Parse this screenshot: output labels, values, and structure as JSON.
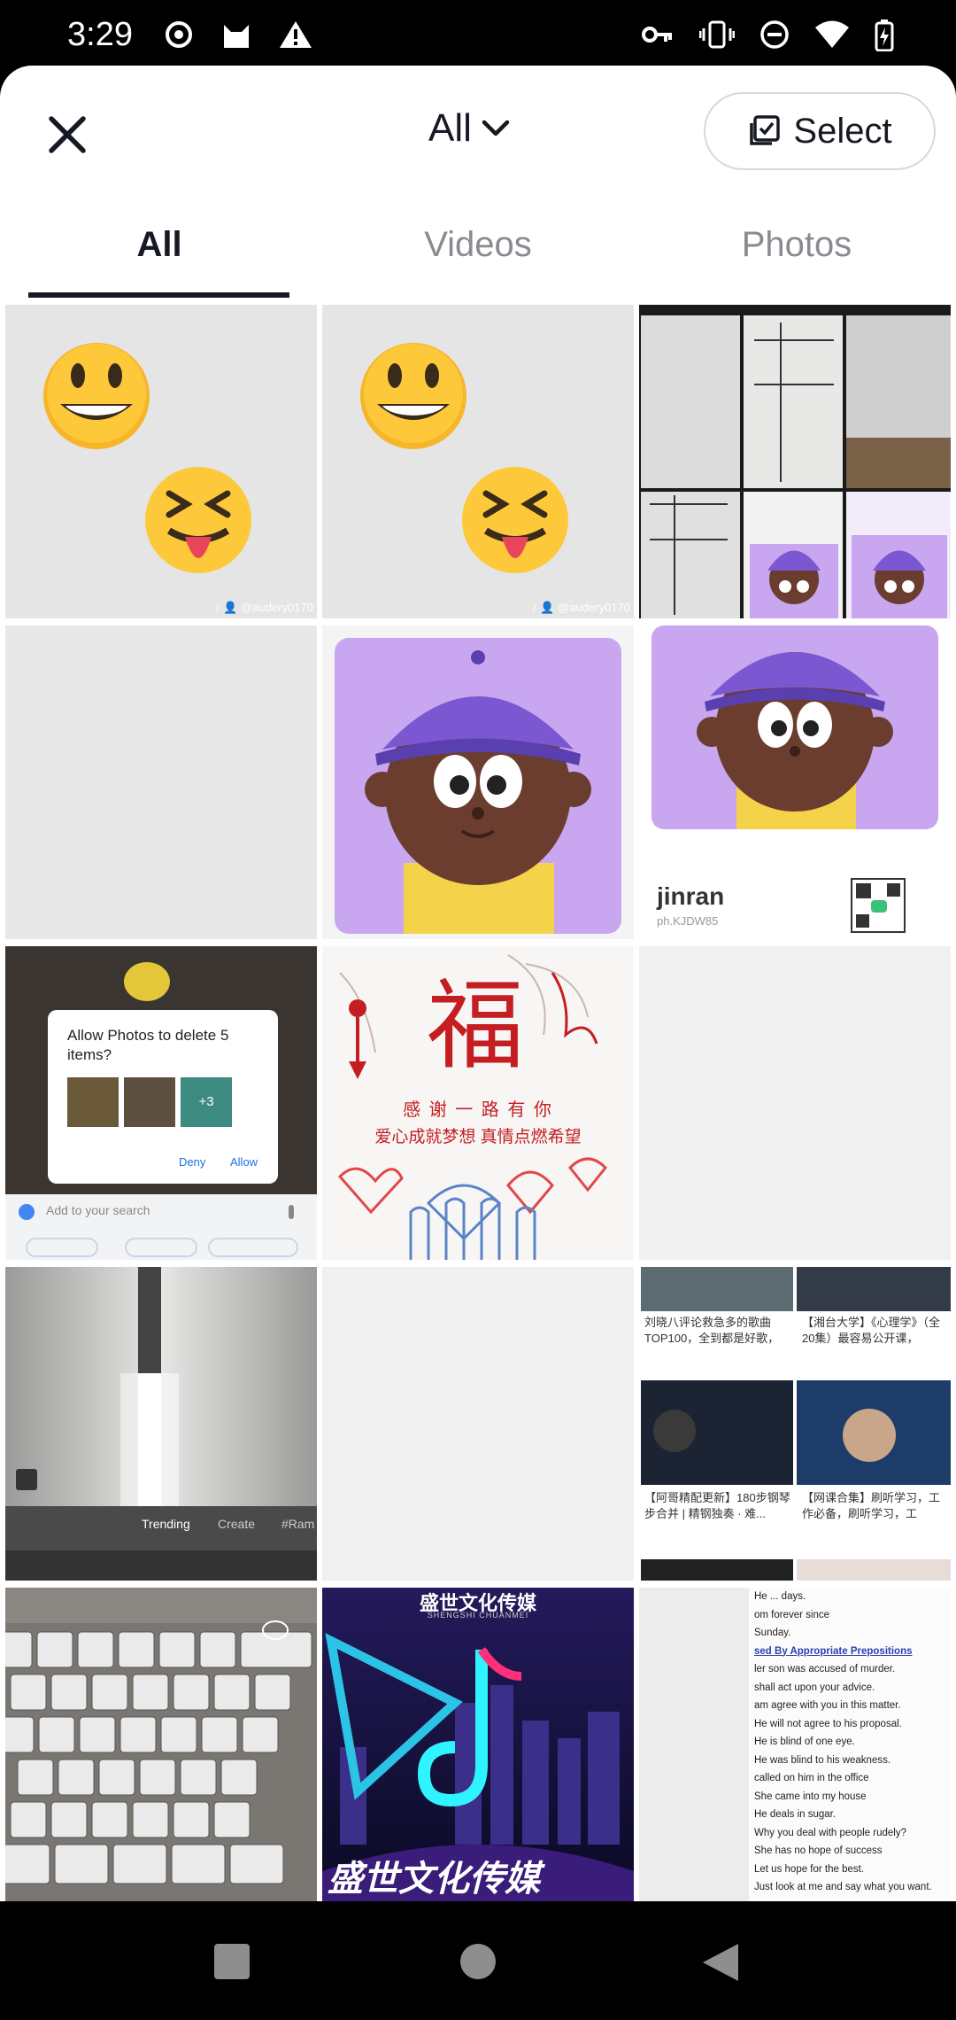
{
  "status_bar": {
    "time": "3:29",
    "left_icons": [
      "record-icon",
      "cat-icon",
      "warning-icon"
    ],
    "right_icons": [
      "key-icon",
      "vibrate-icon",
      "dnd-icon",
      "wifi-icon",
      "battery-charging-icon"
    ]
  },
  "header": {
    "album_label": "All",
    "select_label": "Select"
  },
  "tabs": [
    {
      "label": "All",
      "active": true
    },
    {
      "label": "Videos",
      "active": false
    },
    {
      "label": "Photos",
      "active": false
    }
  ],
  "thumbnails": {
    "emoji_watermark": "♪ 👤 @audery0170",
    "avatar_name": "jinran",
    "avatar_id": "ph.KJDW85",
    "dialog_title": "Allow Photos to delete 5 items?",
    "dialog_plus": "+3",
    "dialog_deny": "Deny",
    "dialog_allow": "Allow",
    "search_placeholder": "Add to your search",
    "fu_char": "福",
    "fu_line1": "感 谢 一 路 有 你",
    "fu_line2": "爱心成就梦想  真情点燃希望",
    "trending_tab": "Trending",
    "create_tab": "Create",
    "hashtag_tab": "#Ram",
    "media_brand_top": "盛世文化传媒",
    "media_brand_sub": "SHENGSHI CHUANMEI",
    "media_brand": "盛世文化传媒",
    "news1": "刘晓八评论救急多的歌曲TOP100，全到都是好歌，",
    "news2": "【湘台大学】《心理学》（全20集）最容易公开课，",
    "news3": "【阿哥精配更新】180步钢琴步合并 | 精钢独奏 · 难...",
    "news4": "【网课合集】刷听学习，工作必备，刷听学习，工",
    "eng_lines": [
      "He ... days.",
      "om forever since",
      "Sunday.",
      "sed By Appropriate Prepositions",
      "ler son was accused of murder.",
      "shall act upon your advice.",
      "am agree with you in this matter.",
      "He will not agree to his proposal.",
      "He is blind of one eye.",
      "He was blind to his weakness.",
      "called on him in the office",
      "She came into my house",
      "He deals in sugar.",
      "Why you deal with people rudely?",
      "She has no hope of success",
      "Let us hope for the best.",
      "Just look at me and say what you want."
    ]
  },
  "nav_bar": {
    "icons": [
      "recents-square-icon",
      "home-circle-icon",
      "back-triangle-icon"
    ]
  },
  "colors": {
    "sheet_bg": "#ffffff",
    "text_primary": "#161823",
    "text_secondary": "#8a8b91",
    "purple_bg": "#c9a6f0",
    "cap_purple": "#7b57d1",
    "skin_brown": "#6b3d2e",
    "shirt_yellow": "#f4d24a"
  }
}
